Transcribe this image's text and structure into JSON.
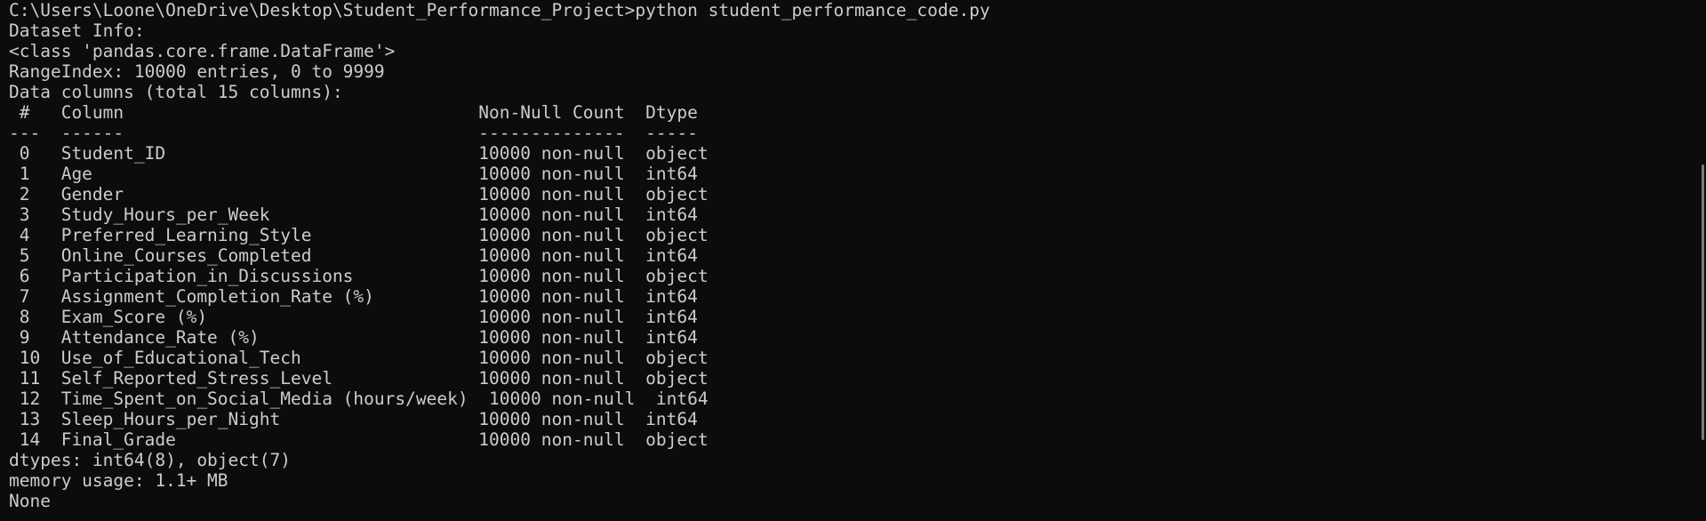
{
  "terminal": {
    "lines": [
      "C:\\Users\\Loone\\OneDrive\\Desktop\\Student_Performance_Project>python student_performance_code.py",
      "Dataset Info:",
      "<class 'pandas.core.frame.DataFrame'>",
      "RangeIndex: 10000 entries, 0 to 9999",
      "Data columns (total 15 columns):",
      " #   Column                                  Non-Null Count  Dtype ",
      "---  ------                                  --------------  ----- ",
      " 0   Student_ID                              10000 non-null  object",
      " 1   Age                                     10000 non-null  int64 ",
      " 2   Gender                                  10000 non-null  object",
      " 3   Study_Hours_per_Week                    10000 non-null  int64 ",
      " 4   Preferred_Learning_Style                10000 non-null  object",
      " 5   Online_Courses_Completed                10000 non-null  int64 ",
      " 6   Participation_in_Discussions            10000 non-null  object",
      " 7   Assignment_Completion_Rate (%)          10000 non-null  int64 ",
      " 8   Exam_Score (%)                          10000 non-null  int64 ",
      " 9   Attendance_Rate (%)                     10000 non-null  int64 ",
      " 10  Use_of_Educational_Tech                 10000 non-null  object",
      " 11  Self_Reported_Stress_Level              10000 non-null  object",
      " 12  Time_Spent_on_Social_Media (hours/week)  10000 non-null  int64 ",
      " 13  Sleep_Hours_per_Night                   10000 non-null  int64 ",
      " 14  Final_Grade                             10000 non-null  object",
      "dtypes: int64(8), object(7)",
      "memory usage: 1.1+ MB",
      "None"
    ]
  },
  "colors": {
    "background": "#0c0c0c",
    "foreground": "#cccccc",
    "scrollbar_thumb": "#7a7a7a"
  }
}
